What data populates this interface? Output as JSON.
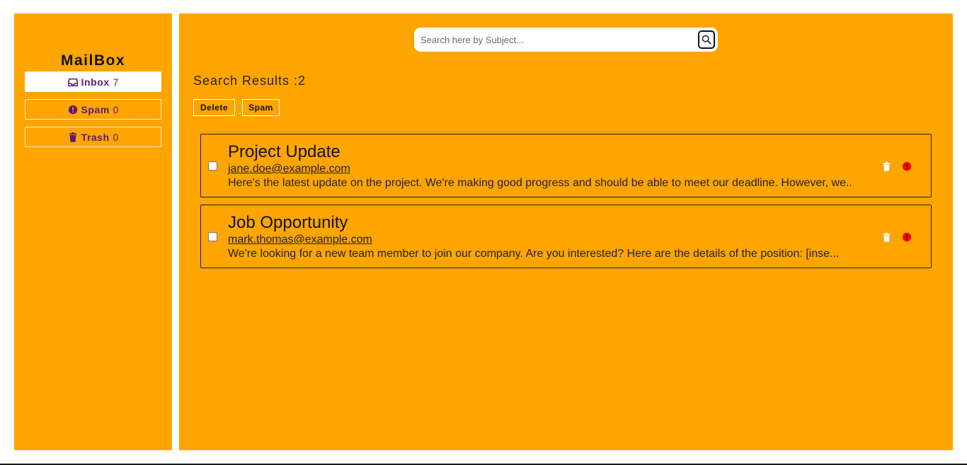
{
  "sidebar": {
    "brand": "MailBox",
    "items": [
      {
        "label": "Inbox",
        "count": "7",
        "icon": "inbox-icon",
        "active": true
      },
      {
        "label": "Spam",
        "count": "0",
        "icon": "exclamation-circle-icon",
        "active": false
      },
      {
        "label": "Trash",
        "count": "0",
        "icon": "trash-icon",
        "active": false
      }
    ]
  },
  "search": {
    "placeholder": "Search here by Subject...",
    "value": "",
    "button_icon": "search-icon"
  },
  "results": {
    "title": "Search Results :2"
  },
  "actions": {
    "delete_label": "Delete",
    "spam_label": "Spam"
  },
  "emails": [
    {
      "subject": "Project Update",
      "sender": "jane.doe@example.com",
      "preview": "Here's the latest update on the project. We're making good progress and should be able to meet our deadline. However, we...",
      "trash_icon": "trash-icon",
      "spam_icon": "exclamation-circle-icon"
    },
    {
      "subject": "Job Opportunity",
      "sender": "mark.thomas@example.com",
      "preview": "We're looking for a new team member to join our company. Are you interested? Here are the details of the position: [inse...",
      "trash_icon": "trash-icon",
      "spam_icon": "exclamation-circle-icon"
    }
  ],
  "colors": {
    "background": "#ffa500",
    "nav_text": "#5a1a7a",
    "spam_icon": "#ff0000",
    "trash_icon": "#ffffff"
  }
}
